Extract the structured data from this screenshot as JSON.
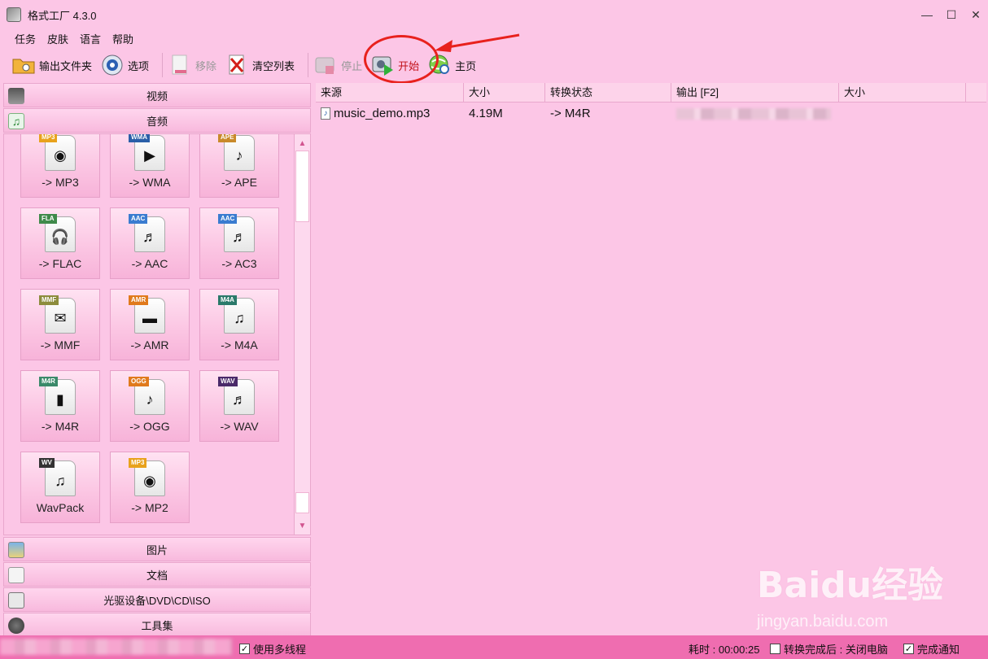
{
  "window": {
    "title": "格式工厂 4.3.0",
    "minimize": "—",
    "maximize": "☐",
    "close": "✕"
  },
  "menu": [
    "任务",
    "皮肤",
    "语言",
    "帮助"
  ],
  "toolbar": {
    "output_folder": "输出文件夹",
    "options": "选项",
    "remove": "移除",
    "clear_list": "清空列表",
    "stop": "停止",
    "start": "开始",
    "home": "主页"
  },
  "categories": {
    "video": "视频",
    "audio": "音频",
    "picture": "图片",
    "document": "文档",
    "rom": "光驱设备\\DVD\\CD\\ISO",
    "tools": "工具集"
  },
  "audio_formats": [
    {
      "tag": "MP3",
      "label": "-> MP3",
      "color": "#e8a21c"
    },
    {
      "tag": "WMA",
      "label": "-> WMA",
      "color": "#2a5fa8"
    },
    {
      "tag": "APE",
      "label": "-> APE",
      "color": "#c98a2a"
    },
    {
      "tag": "FLA",
      "label": "-> FLAC",
      "color": "#3f8a4a"
    },
    {
      "tag": "AAC",
      "label": "-> AAC",
      "color": "#3a7cd0"
    },
    {
      "tag": "AAC",
      "label": "-> AC3",
      "color": "#3a7cd0"
    },
    {
      "tag": "MMF",
      "label": "-> MMF",
      "color": "#8c8c3c"
    },
    {
      "tag": "AMR",
      "label": "-> AMR",
      "color": "#e07a1c"
    },
    {
      "tag": "M4A",
      "label": "-> M4A",
      "color": "#2a7a6a"
    },
    {
      "tag": "M4R",
      "label": "-> M4R",
      "color": "#3a8a6a"
    },
    {
      "tag": "OGG",
      "label": "-> OGG",
      "color": "#e07a1c"
    },
    {
      "tag": "WAV",
      "label": "-> WAV",
      "color": "#4a2a6a"
    },
    {
      "tag": "WV",
      "label": "WavPack",
      "color": "#333333"
    },
    {
      "tag": "MP3",
      "label": "-> MP2",
      "color": "#e8a21c"
    }
  ],
  "table": {
    "columns": [
      "来源",
      "大小",
      "转换状态",
      "输出 [F2]",
      "大小"
    ],
    "rows": [
      {
        "source": "music_demo.mp3",
        "size": "4.19M",
        "status": "-> M4R"
      }
    ]
  },
  "watermark": {
    "brand": "Baidu经验",
    "url": "jingyan.baidu.com"
  },
  "status": {
    "multithread": "使用多线程",
    "elapsed": "耗时 : 00:00:25",
    "after_done": "转换完成后 : 关闭电脑",
    "notify": "完成通知"
  }
}
